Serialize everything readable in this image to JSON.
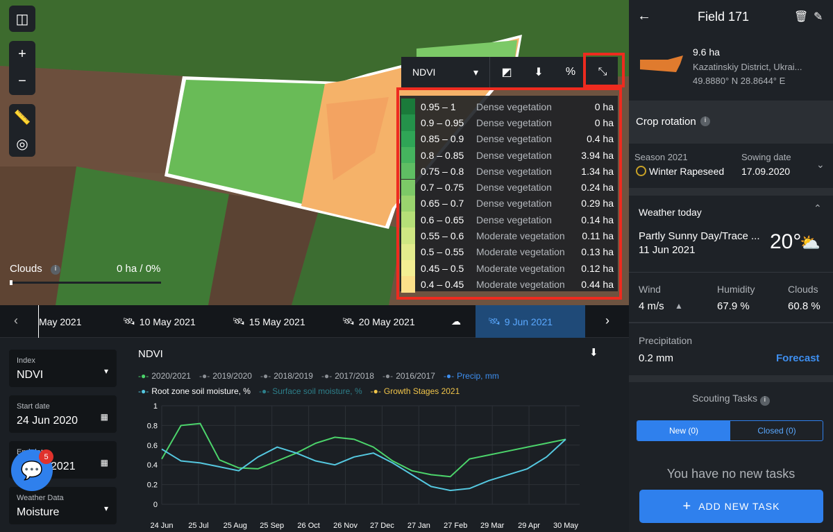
{
  "map": {
    "clouds_label": "Clouds",
    "clouds_value": "0 ha / 0%",
    "index_select": "NDVI",
    "legend": [
      {
        "range": "0.95 – 1",
        "cls": "Dense vegetation",
        "area": "0 ha",
        "color": "#1a7a3a"
      },
      {
        "range": "0.9 – 0.95",
        "cls": "Dense vegetation",
        "area": "0 ha",
        "color": "#24924a"
      },
      {
        "range": "0.85 – 0.9",
        "cls": "Dense vegetation",
        "area": "0.4 ha",
        "color": "#2fa556"
      },
      {
        "range": "0.8 – 0.85",
        "cls": "Dense vegetation",
        "area": "3.94 ha",
        "color": "#45b45e"
      },
      {
        "range": "0.75 – 0.8",
        "cls": "Dense vegetation",
        "area": "1.34 ha",
        "color": "#5fbe63"
      },
      {
        "range": "0.7 – 0.75",
        "cls": "Dense vegetation",
        "area": "0.24 ha",
        "color": "#7cc967"
      },
      {
        "range": "0.65 – 0.7",
        "cls": "Dense vegetation",
        "area": "0.29 ha",
        "color": "#9ad46e"
      },
      {
        "range": "0.6 – 0.65",
        "cls": "Dense vegetation",
        "area": "0.14 ha",
        "color": "#b5df78"
      },
      {
        "range": "0.55 – 0.6",
        "cls": "Moderate vegetation",
        "area": "0.11 ha",
        "color": "#cfe783"
      },
      {
        "range": "0.5 – 0.55",
        "cls": "Moderate vegetation",
        "area": "0.13 ha",
        "color": "#e3ec8d"
      },
      {
        "range": "0.45 – 0.5",
        "cls": "Moderate vegetation",
        "area": "0.12 ha",
        "color": "#f3ee93"
      },
      {
        "range": "0.4 – 0.45",
        "cls": "Moderate vegetation",
        "area": "0.44 ha",
        "color": "#fbe08a"
      }
    ]
  },
  "datebar": {
    "dates": [
      "May 2021",
      "10 May 2021",
      "15 May 2021",
      "20 May 2021",
      "9 Jun 2021"
    ]
  },
  "left": {
    "index_label": "Index",
    "index_value": "NDVI",
    "start_label": "Start date",
    "start_value": "24 Jun 2020",
    "end_label": "End date",
    "end_value": "2021",
    "weather_label": "Weather Data",
    "weather_value": "Moisture",
    "badge": "5"
  },
  "chart": {
    "title": "NDVI",
    "legend": [
      {
        "name": "2020/2021",
        "color": "#4cd46b"
      },
      {
        "name": "2019/2020",
        "color": "#8c9096"
      },
      {
        "name": "2018/2019",
        "color": "#8c9096"
      },
      {
        "name": "2017/2018",
        "color": "#8c9096"
      },
      {
        "name": "2016/2017",
        "color": "#8c9096"
      },
      {
        "name": "Precip, mm",
        "color": "#3e8ff0"
      },
      {
        "name": "Root zone soil moisture, %",
        "color": "#55c8e0"
      },
      {
        "name": "Surface soil moisture, %",
        "color": "#2d7f8a"
      },
      {
        "name": "Growth Stages 2021",
        "color": "#f0c44a"
      }
    ]
  },
  "chart_data": {
    "type": "line",
    "x_ticks": [
      "24 Jun",
      "25 Jul",
      "25 Aug",
      "25 Sep",
      "26 Oct",
      "26 Nov",
      "27 Dec",
      "27 Jan",
      "27 Feb",
      "29 Mar",
      "29 Apr",
      "30 May"
    ],
    "y_ticks": [
      "0",
      "0.2",
      "0.4",
      "0.6",
      "0.8",
      "1"
    ],
    "ylim": [
      0,
      1
    ],
    "series": [
      {
        "name": "2020/2021",
        "values": [
          0.46,
          0.8,
          0.82,
          0.45,
          0.37,
          0.36,
          0.44,
          0.52,
          0.62,
          0.68,
          0.66,
          0.58,
          0.44,
          0.34,
          0.3,
          0.28,
          0.46,
          0.5,
          0.54,
          0.58,
          0.62,
          0.66
        ]
      },
      {
        "name": "Root zone soil moisture, %",
        "values": [
          0.56,
          0.44,
          0.42,
          0.38,
          0.34,
          0.48,
          0.58,
          0.52,
          0.44,
          0.4,
          0.48,
          0.52,
          0.42,
          0.3,
          0.18,
          0.14,
          0.16,
          0.24,
          0.3,
          0.36,
          0.48,
          0.66
        ]
      }
    ]
  },
  "sidebar": {
    "title": "Field 171",
    "area": "9.6 ha",
    "district": "Kazatinskiy District, Ukrai...",
    "coords": "49.8880° N 28.8644° E",
    "crop_rotation": "Crop rotation",
    "season_label": "Season 2021",
    "season_value": "Winter Rapeseed",
    "sowing_label": "Sowing date",
    "sowing_value": "17.09.2020",
    "weather_title": "Weather today",
    "weather_desc": "Partly Sunny Day/Trace ...",
    "weather_date": "11 Jun 2021",
    "temp": "20°",
    "wind_label": "Wind",
    "wind_value": "4 m/s",
    "hum_label": "Humidity",
    "hum_value": "67.9 %",
    "clouds_label": "Clouds",
    "clouds_value": "60.8 %",
    "precip_label": "Precipitation",
    "precip_value": "0.2 mm",
    "forecast": "Forecast",
    "scouting": "Scouting Tasks",
    "tab_new": "New (0)",
    "tab_closed": "Closed (0)",
    "no_tasks": "You have no new tasks",
    "add_task": "ADD NEW TASK"
  }
}
